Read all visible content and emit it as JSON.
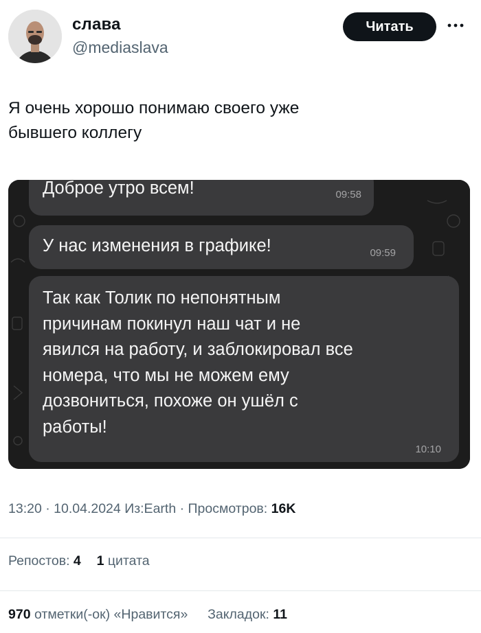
{
  "author": {
    "display_name": "слава",
    "handle": "@mediaslava"
  },
  "header": {
    "read_button_label": "Читать",
    "more_icon": "more-horizontal-icon"
  },
  "tweet": {
    "text_lines": [
      "Я очень хорошо понимаю своего уже",
      "бывшего коллегу"
    ]
  },
  "chat": {
    "messages": [
      {
        "text_lines": [
          "Доброе утро всем!"
        ],
        "time": "09:58"
      },
      {
        "text_lines": [
          "У нас изменения в графике!"
        ],
        "time": "09:59"
      },
      {
        "text_lines": [
          "Так как Толик по непонятным",
          "причинам покинул наш чат и не",
          "явился на работу, и заблокировал все",
          "номера, что мы не можем ему",
          "дозвониться, похоже он ушёл с",
          "работы!"
        ],
        "time": "10:10"
      }
    ],
    "colors": {
      "background": "#1e1e1e",
      "bubble": "#3a3a3c"
    }
  },
  "meta": {
    "time": "13:20",
    "separator": " · ",
    "date": "10.04.2024",
    "source": "Из:Earth",
    "views_label": "Просмотров:",
    "views_value": "16K"
  },
  "stats": {
    "reposts_label": "Репостов:",
    "reposts_value": "4",
    "quotes_value": "1",
    "quotes_label": "цитата",
    "likes_value": "970",
    "likes_label": "отметки(-ок) «Нравится»",
    "bookmarks_label": "Закладок:",
    "bookmarks_value": "11"
  }
}
